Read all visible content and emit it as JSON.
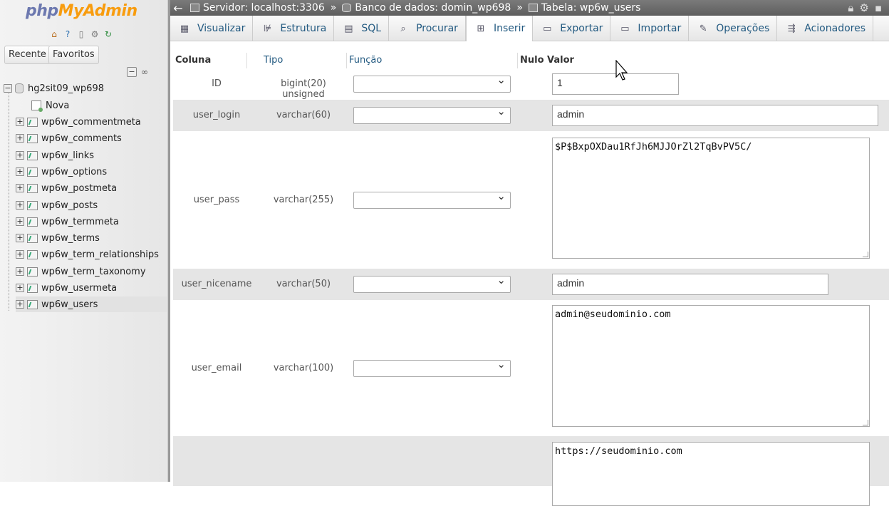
{
  "nav": {
    "logo_php": "php",
    "logo_myadmin": "MyAdmin",
    "recent_label": "Recente",
    "favorites_label": "Favoritos",
    "database": "hg2sit09_wp698",
    "new_label": "Nova",
    "tables": [
      "wp6w_commentmeta",
      "wp6w_comments",
      "wp6w_links",
      "wp6w_options",
      "wp6w_postmeta",
      "wp6w_posts",
      "wp6w_termmeta",
      "wp6w_terms",
      "wp6w_term_relationships",
      "wp6w_term_taxonomy",
      "wp6w_usermeta",
      "wp6w_users"
    ],
    "selected_table": "wp6w_users"
  },
  "breadcrumb": {
    "server": "Servidor: localhost:3306",
    "database": "Banco de dados: domin_wp698",
    "table": "Tabela: wp6w_users",
    "separator": "»"
  },
  "tabs": [
    {
      "label": "Visualizar",
      "icon": "browse-icon"
    },
    {
      "label": "Estrutura",
      "icon": "structure-icon"
    },
    {
      "label": "SQL",
      "icon": "sql-icon"
    },
    {
      "label": "Procurar",
      "icon": "search-icon"
    },
    {
      "label": "Inserir",
      "icon": "insert-icon",
      "active": true
    },
    {
      "label": "Exportar",
      "icon": "export-icon"
    },
    {
      "label": "Importar",
      "icon": "import-icon"
    },
    {
      "label": "Operações",
      "icon": "operations-icon"
    },
    {
      "label": "Acionadores",
      "icon": "triggers-icon"
    }
  ],
  "form": {
    "headers": {
      "column": "Coluna",
      "type": "Tipo",
      "function": "Função",
      "null": "Nulo",
      "value": "Valor"
    },
    "rows": [
      {
        "column": "ID",
        "type": "bigint(20) unsigned",
        "value": "1"
      },
      {
        "column": "user_login",
        "type": "varchar(60)",
        "value": "admin"
      },
      {
        "column": "user_pass",
        "type": "varchar(255)",
        "value": "$P$BxpOXDau1RfJh6MJJOrZl2TqBvPV5C/"
      },
      {
        "column": "user_nicename",
        "type": "varchar(50)",
        "value": "admin"
      },
      {
        "column": "user_email",
        "type": "varchar(100)",
        "value": "admin@seudominio.com"
      },
      {
        "column": "",
        "type": "",
        "value": "https://seudominio.com"
      }
    ]
  },
  "colors": {
    "link": "#235a81",
    "logo_php": "#6c78af",
    "logo_myadmin": "#f89c0e",
    "topbar": "#666666",
    "shaded_row": "#e5e5e5"
  }
}
